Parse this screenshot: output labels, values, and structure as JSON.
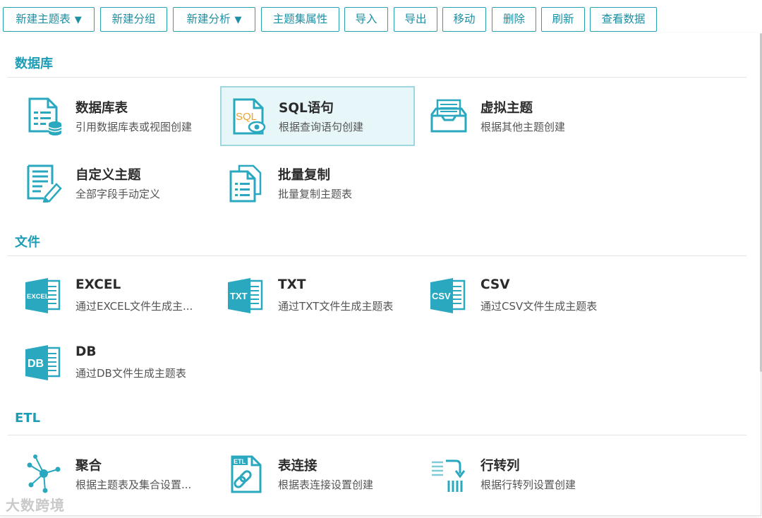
{
  "toolbar": {
    "new_table": "新建主题表",
    "new_group": "新建分组",
    "new_analysis": "新建分析",
    "properties": "主题集属性",
    "import": "导入",
    "export": "导出",
    "move": "移动",
    "delete": "删除",
    "refresh": "刷新",
    "view_data": "查看数据",
    "caret": "▼"
  },
  "sections": {
    "database": {
      "title": "数据库",
      "items": [
        {
          "title": "数据库表",
          "desc": "引用数据库表或视图创建",
          "icon": "database-table-icon"
        },
        {
          "title": "SQL语句",
          "desc": "根据查询语句创建",
          "icon": "sql-icon",
          "selected": true,
          "icon_text": "SQL"
        },
        {
          "title": "虚拟主题",
          "desc": "根据其他主题创建",
          "icon": "inbox-icon"
        },
        {
          "title": "自定义主题",
          "desc": "全部字段手动定义",
          "icon": "edit-document-icon"
        },
        {
          "title": "批量复制",
          "desc": "批量复制主题表",
          "icon": "copy-documents-icon"
        }
      ]
    },
    "file": {
      "title": "文件",
      "items": [
        {
          "title": "EXCEL",
          "desc": "通过EXCEL文件生成主...",
          "icon": "excel-file-icon",
          "icon_text": "EXCEL"
        },
        {
          "title": "TXT",
          "desc": "通过TXT文件生成主题表",
          "icon": "txt-file-icon",
          "icon_text": "TXT"
        },
        {
          "title": "CSV",
          "desc": "通过CSV文件生成主题表",
          "icon": "csv-file-icon",
          "icon_text": "CSV"
        },
        {
          "title": "DB",
          "desc": "通过DB文件生成主题表",
          "icon": "db-file-icon",
          "icon_text": "DB"
        }
      ]
    },
    "etl": {
      "title": "ETL",
      "items": [
        {
          "title": "聚合",
          "desc": "根据主题表及集合设置...",
          "icon": "aggregate-icon"
        },
        {
          "title": "表连接",
          "desc": "根据表连接设置创建",
          "icon": "table-join-icon",
          "icon_text": "ETL"
        },
        {
          "title": "行转列",
          "desc": "根据行转列设置创建",
          "icon": "pivot-icon"
        }
      ]
    }
  },
  "watermark": "大数跨境",
  "colors": {
    "accent": "#1d9cb5",
    "icon": "#2aa8bf",
    "selected_bg": "#e7f6f9",
    "selected_border": "#9ed7df"
  }
}
